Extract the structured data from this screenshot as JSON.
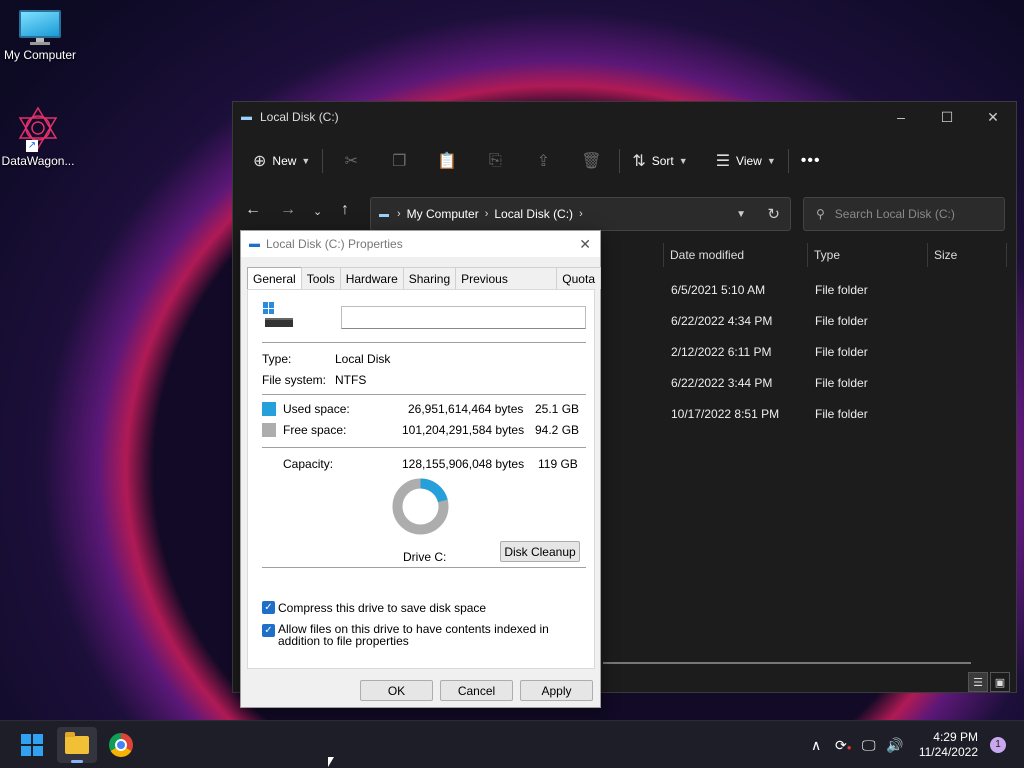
{
  "desktop": {
    "icons": [
      {
        "label": "My Computer",
        "icon": "monitor-icon"
      },
      {
        "label": "DataWagon...",
        "icon": "datawagon-logo-icon"
      }
    ]
  },
  "explorer": {
    "title": "Local Disk (C:)",
    "commands": {
      "new": "New",
      "sort": "Sort",
      "view": "View"
    },
    "breadcrumb": [
      "My Computer",
      "Local Disk (C:)"
    ],
    "search_placeholder": "Search Local Disk (C:)",
    "columns": [
      "Date modified",
      "Type",
      "Size"
    ],
    "rows": [
      {
        "date": "6/5/2021 5:10 AM",
        "type": "File folder"
      },
      {
        "date": "6/22/2022 4:34 PM",
        "type": "File folder"
      },
      {
        "date": "2/12/2022 6:11 PM",
        "type": "File folder"
      },
      {
        "date": "6/22/2022 3:44 PM",
        "type": "File folder"
      },
      {
        "date": "10/17/2022 8:51 PM",
        "type": "File folder"
      }
    ]
  },
  "properties": {
    "title": "Local Disk (C:) Properties",
    "tabs": [
      "General",
      "Tools",
      "Hardware",
      "Sharing",
      "Previous Versions",
      "Quota"
    ],
    "active_tab": "General",
    "name_value": "",
    "type_label": "Type:",
    "type_value": "Local Disk",
    "fs_label": "File system:",
    "fs_value": "NTFS",
    "used_label": "Used space:",
    "used_bytes": "26,951,614,464 bytes",
    "used_gb": "25.1 GB",
    "free_label": "Free space:",
    "free_bytes": "101,204,291,584 bytes",
    "free_gb": "94.2 GB",
    "capacity_label": "Capacity:",
    "capacity_bytes": "128,155,906,048 bytes",
    "capacity_gb": "119 GB",
    "used_fraction": 0.21,
    "used_color": "#26a0da",
    "free_color": "#adadad",
    "drive_label": "Drive C:",
    "cleanup_button": "Disk Cleanup",
    "compress_label": "Compress this drive to save disk space",
    "index_label": "Allow files on this drive to have contents indexed in addition to file properties",
    "compress_checked": true,
    "index_checked": true,
    "ok": "OK",
    "cancel": "Cancel",
    "apply": "Apply"
  },
  "taskbar": {
    "time": "4:29 PM",
    "date": "11/24/2022",
    "notifications": "1"
  }
}
